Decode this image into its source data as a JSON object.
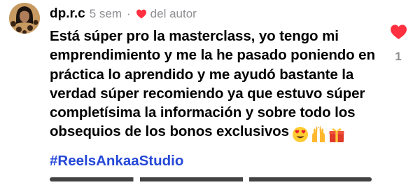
{
  "comment": {
    "username": "dp.r.c",
    "time": "5 sem",
    "separator": "·",
    "author_label": "del autor",
    "text": "Está súper pro la masterclass, yo tengo mi emprendimiento y me la he pasado poniendo en práctica lo aprendido y me ayudó bastante la verdad súper recomiendo ya que estuvo súper completísima la información y sobre todo los obsequios de los bonos exclusivos",
    "emojis": [
      "heart-eyes-emoji",
      "raising-hands-emoji",
      "gift-emoji"
    ],
    "hashtag": "#ReelsAnkaaStudio",
    "like_count": "1"
  },
  "colors": {
    "heart": "#ff3040",
    "hashtag": "#2548d8",
    "secondary_text": "#8e8e93"
  },
  "icons": {
    "author_heart": "heart-icon",
    "like": "heart-icon"
  }
}
